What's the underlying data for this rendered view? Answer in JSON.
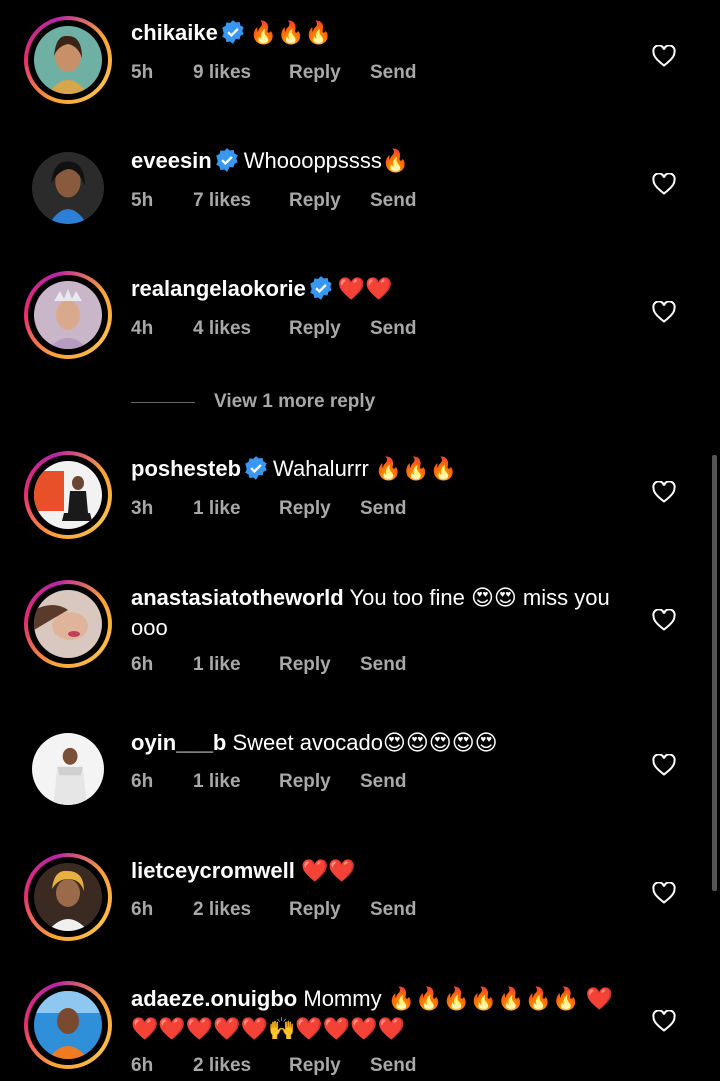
{
  "comments": [
    {
      "username": "chikaike",
      "verified": true,
      "text": "🔥🔥🔥",
      "time": "5h",
      "likes": "9 likes",
      "reply": "Reply",
      "send": "Send",
      "ring": true
    },
    {
      "username": "eveesin",
      "verified": true,
      "text": "Whoooppssss🔥",
      "time": "5h",
      "likes": "7 likes",
      "reply": "Reply",
      "send": "Send",
      "ring": false
    },
    {
      "username": "realangelaokorie",
      "verified": true,
      "text": "❤️❤️",
      "time": "4h",
      "likes": "4 likes",
      "reply": "Reply",
      "send": "Send",
      "ring": true
    },
    {
      "username": "poshesteb",
      "verified": true,
      "text": "Wahalurrr 🔥🔥🔥",
      "time": "3h",
      "likes": "1 like",
      "reply": "Reply",
      "send": "Send",
      "ring": true
    },
    {
      "username": "anastasiatotheworld",
      "verified": false,
      "text": "You too fine 😍😍 miss you ooo",
      "time": "6h",
      "likes": "1 like",
      "reply": "Reply",
      "send": "Send",
      "ring": true
    },
    {
      "username": "oyin___b",
      "verified": false,
      "text": "Sweet avocado😍😍😍😍😍",
      "time": "6h",
      "likes": "1 like",
      "reply": "Reply",
      "send": "Send",
      "ring": false
    },
    {
      "username": "lietceycromwell",
      "verified": false,
      "text": "❤️❤️",
      "time": "6h",
      "likes": "2 likes",
      "reply": "Reply",
      "send": "Send",
      "ring": true
    },
    {
      "username": "adaeze.onuigbo",
      "verified": false,
      "text": "Mommy 🔥🔥🔥🔥🔥🔥🔥 ❤️❤️❤️❤️❤️❤️🙌❤️❤️❤️❤️",
      "time": "6h",
      "likes": "2 likes",
      "reply": "Reply",
      "send": "Send",
      "ring": true
    }
  ],
  "view_more_replies": "View 1 more reply",
  "colors": {
    "background": "#000000",
    "meta": "#a8a8a8",
    "verified": "#3897f0"
  },
  "icons": {
    "like": "heart-outline-icon",
    "verified": "verified-badge-icon"
  }
}
